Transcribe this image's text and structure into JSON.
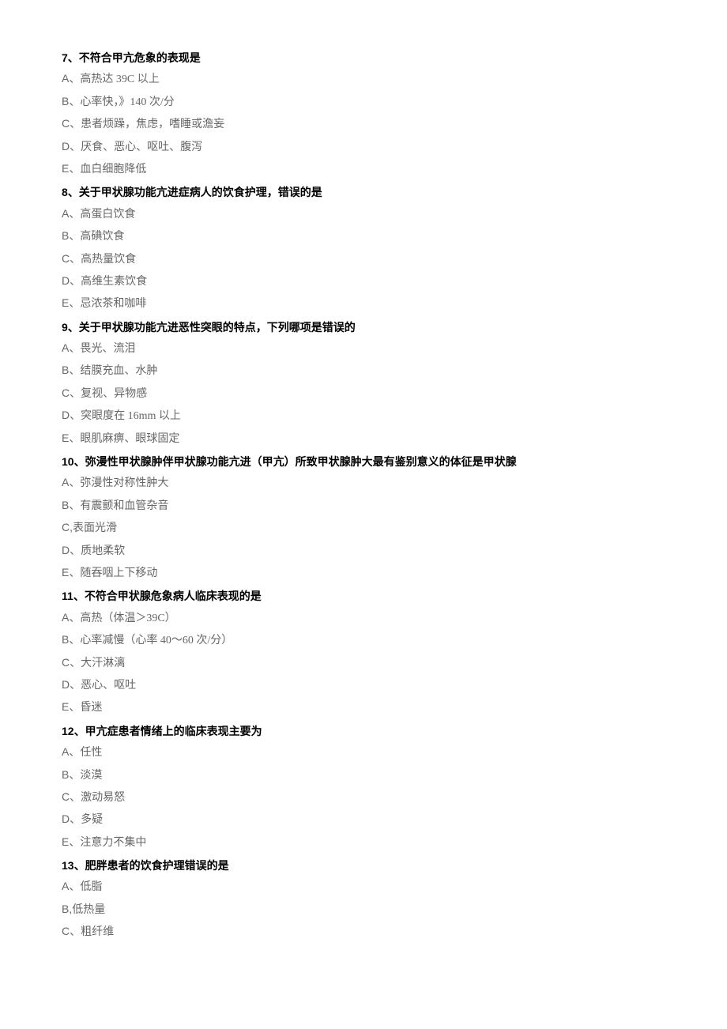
{
  "questions": [
    {
      "number": "7",
      "text": "不符合甲亢危象的表现是",
      "options": [
        {
          "label": "A、",
          "text": "高热达 39C 以上"
        },
        {
          "label": "B、",
          "text": "心率快，》140 次/分"
        },
        {
          "label": "C、",
          "text": "患者烦躁，焦虑，嗜睡或澹妄"
        },
        {
          "label": "D、",
          "text": "厌食、恶心、呕吐、腹泻"
        },
        {
          "label": "E、",
          "text": "血白细胞降低"
        }
      ]
    },
    {
      "number": "8",
      "text": "关于甲状腺功能亢进症病人的饮食护理，错误的是",
      "options": [
        {
          "label": "A、",
          "text": "高蛋白饮食"
        },
        {
          "label": "B、",
          "text": "高碘饮食"
        },
        {
          "label": "C、",
          "text": "高热量饮食"
        },
        {
          "label": "D、",
          "text": "高维生素饮食"
        },
        {
          "label": "E、",
          "text": "忌浓茶和咖啡"
        }
      ]
    },
    {
      "number": "9",
      "text": "关于甲状腺功能亢进恶性突眼的特点，下列哪项是错误的",
      "options": [
        {
          "label": "A、",
          "text": "畏光、流泪"
        },
        {
          "label": "B、",
          "text": "结膜充血、水肿"
        },
        {
          "label": "C、",
          "text": "复视、异物感"
        },
        {
          "label": "D、",
          "text": "突眼度在 16mm 以上"
        },
        {
          "label": "E、",
          "text": "眼肌麻痹、眼球固定"
        }
      ]
    },
    {
      "number": "10",
      "text": "弥漫性甲状腺肿伴甲状腺功能亢进（甲亢）所致甲状腺肿大最有鉴别意义的体征是甲状腺",
      "options": [
        {
          "label": "A、",
          "text": "弥漫性对称性肿大"
        },
        {
          "label": "B、",
          "text": "有震颤和血管杂音"
        },
        {
          "label": "C,",
          "text": "表面光滑"
        },
        {
          "label": "D、",
          "text": "质地柔软"
        },
        {
          "label": "E、",
          "text": "随吞咽上下移动"
        }
      ]
    },
    {
      "number": "11",
      "text": "不符合甲状腺危象病人临床表现的是",
      "options": [
        {
          "label": "A、",
          "text": "高热（体温＞39C）"
        },
        {
          "label": "B、",
          "text": "心率减慢（心率 40～60 次/分）"
        },
        {
          "label": "C、",
          "text": "大汗淋漓"
        },
        {
          "label": "D、",
          "text": "恶心、呕吐"
        },
        {
          "label": "E、",
          "text": "昏迷"
        }
      ]
    },
    {
      "number": "12",
      "text": "甲亢症患者情绪上的临床表现主要为",
      "options": [
        {
          "label": "A、",
          "text": "任性"
        },
        {
          "label": "B、",
          "text": "淡漠"
        },
        {
          "label": "C、",
          "text": "激动易怒"
        },
        {
          "label": "D、",
          "text": "多疑"
        },
        {
          "label": "E、",
          "text": "注意力不集中"
        }
      ]
    },
    {
      "number": "13",
      "text": "肥胖患者的饮食护理错误的是",
      "options": [
        {
          "label": "A、",
          "text": "低脂"
        },
        {
          "label": "B,",
          "text": "低热量"
        },
        {
          "label": "C、",
          "text": "粗纤维"
        }
      ]
    }
  ]
}
